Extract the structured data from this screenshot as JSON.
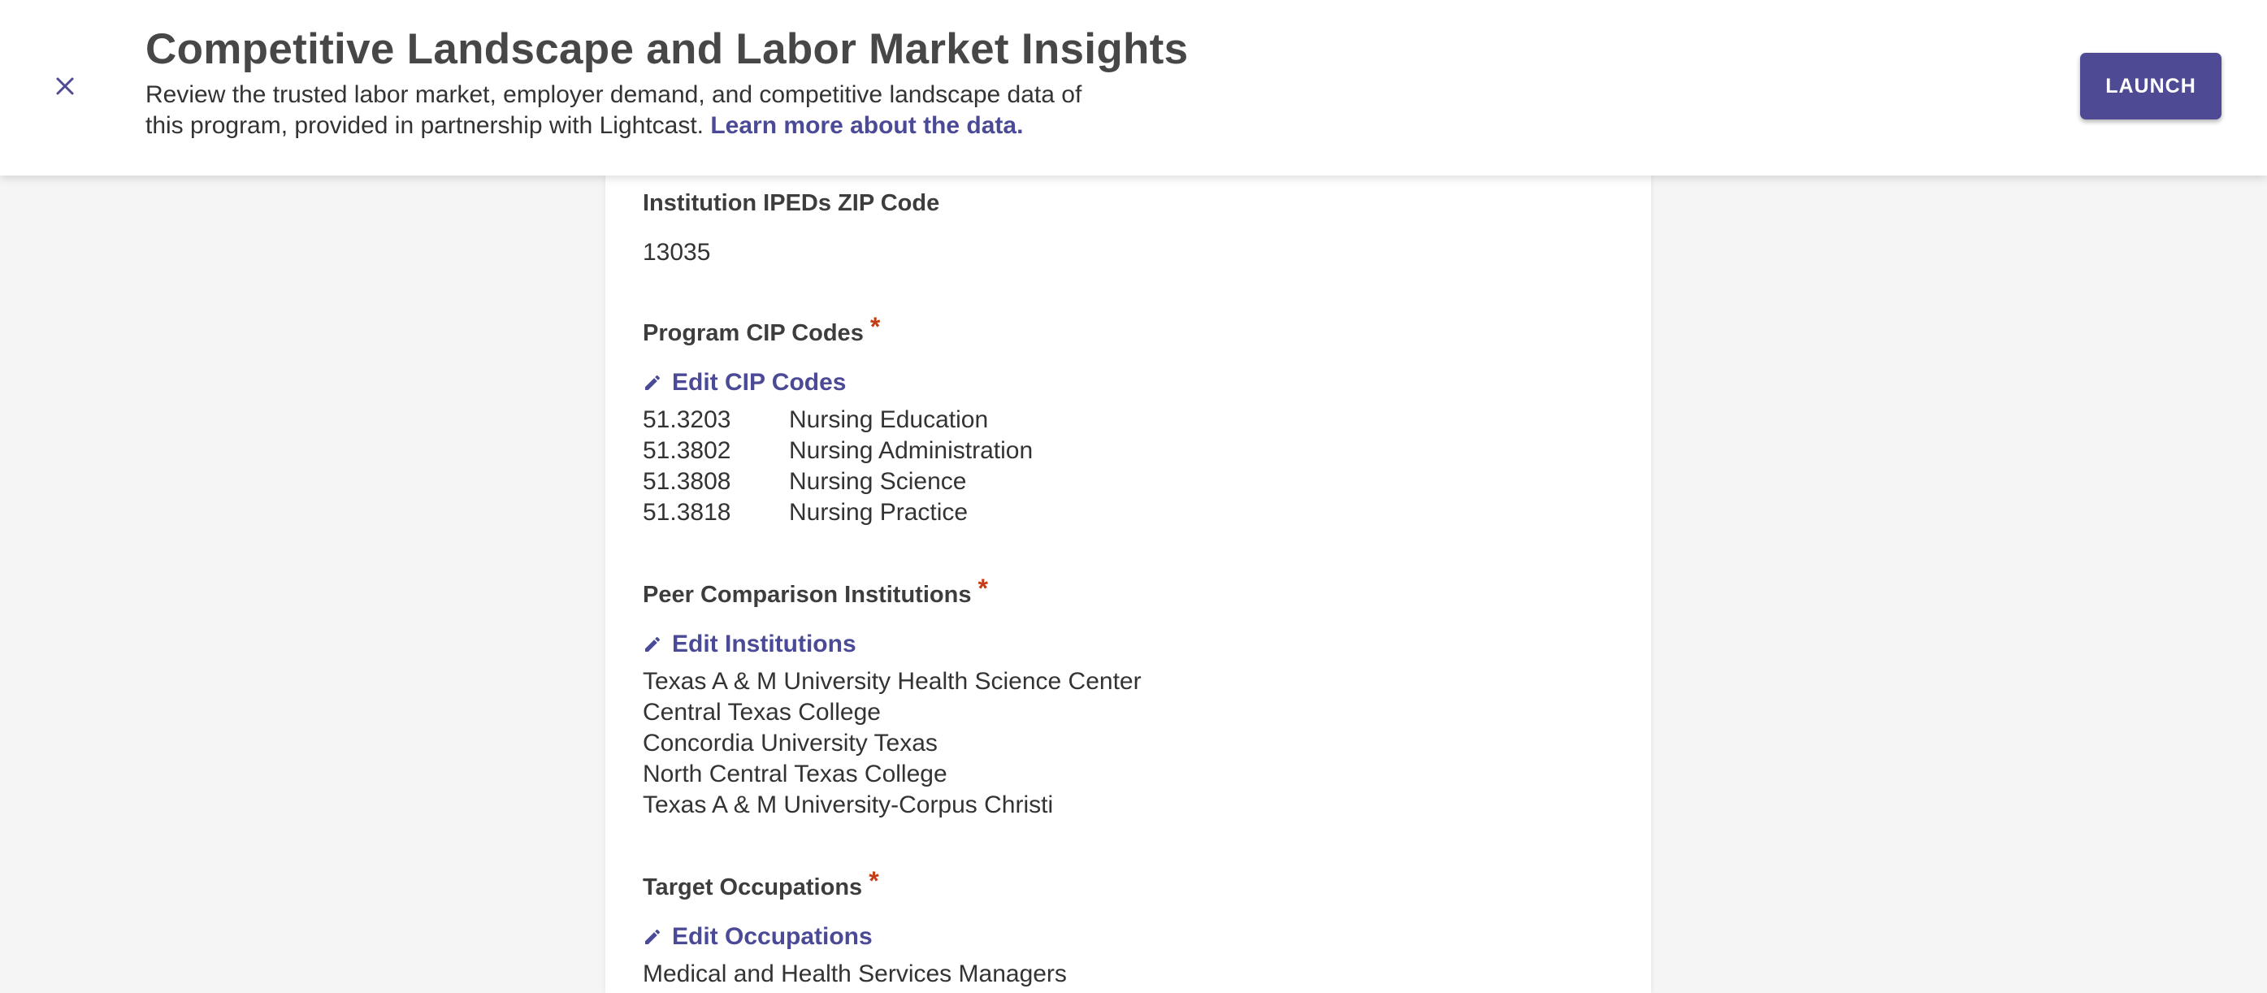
{
  "header": {
    "title": "Competitive Landscape and Labor Market Insights",
    "description": "Review the trusted labor market, employer demand, and competitive landscape data of this program, provided in partnership with Lightcast.",
    "link_text": "Learn more about the data.",
    "launch_label": "LAUNCH",
    "close_icon": "close-icon"
  },
  "colors": {
    "accent": "#4e4b94",
    "link": "#4b4a96",
    "required": "#c43d16"
  },
  "zip": {
    "label": "Institution IPEDs ZIP Code",
    "value": "13035"
  },
  "cip": {
    "label": "Program CIP Codes",
    "required_mark": "*",
    "edit_label": "Edit CIP Codes",
    "edit_icon": "pencil-icon",
    "items": [
      {
        "code": "51.3203",
        "name": "Nursing Education"
      },
      {
        "code": "51.3802",
        "name": "Nursing Administration"
      },
      {
        "code": "51.3808",
        "name": "Nursing Science"
      },
      {
        "code": "51.3818",
        "name": "Nursing Practice"
      }
    ]
  },
  "peers": {
    "label": "Peer Comparison Institutions",
    "required_mark": "*",
    "edit_label": "Edit Institutions",
    "edit_icon": "pencil-icon",
    "items": [
      "Texas A & M University Health Science Center",
      "Central Texas College",
      "Concordia University Texas",
      "North Central Texas College",
      "Texas A & M University-Corpus Christi"
    ]
  },
  "occupations": {
    "label": "Target Occupations",
    "required_mark": "*",
    "edit_label": "Edit Occupations",
    "edit_icon": "pencil-icon",
    "items": [
      "Medical and Health Services Managers"
    ]
  }
}
